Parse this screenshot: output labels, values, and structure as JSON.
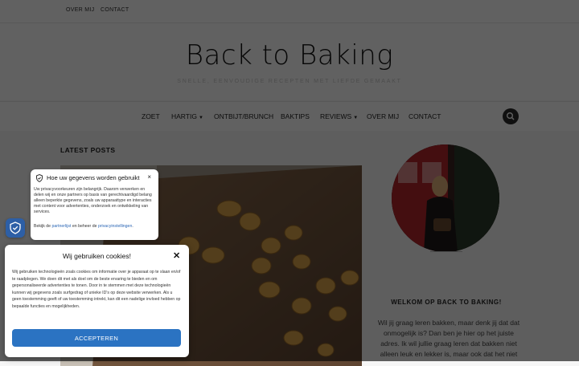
{
  "topnav": {
    "items": [
      {
        "label": "OVER MIJ"
      },
      {
        "label": "CONTACT"
      }
    ]
  },
  "site": {
    "title": "Back to Baking",
    "tagline": "SNELLE, EENVOUDIGE RECEPTEN MET LIEFDE GEMAAKT"
  },
  "mainnav": {
    "items": [
      {
        "label": "ZOET"
      },
      {
        "label": "HARTIG"
      },
      {
        "label": "ONTBIJT/BRUNCH"
      },
      {
        "label": "BAKTIPS"
      },
      {
        "label": "REVIEWS"
      },
      {
        "label": "OVER MIJ"
      },
      {
        "label": "CONTACT"
      }
    ],
    "search_icon": "search-icon"
  },
  "content": {
    "latest_heading": "LATEST POSTS"
  },
  "sidebar": {
    "welcome_title": "WELKOM OP BACK TO BAKING!",
    "about_text": "Wil jij graag leren bakken, maar denk jij dat dat onmogelijk is? Dan ben je hier op het juiste adres. Ik wil jullie graag leren dat bakken niet alleen leuk en lekker is, maar ook dat het niet"
  },
  "privacy_popup": {
    "title": "Hoe uw gegevens worden gebruikt",
    "body": "Uw privacyvoorkeuren zijn belangrijk. Daarom verwerken en delen wij en onze partners op basis van gerechtvaardigd belang alleen beperkte gegevens, zoals uw apparaattype en interacties met content voor advertenties, onderzoek en ontwikkeling van services.",
    "links_prefix": "Bekijk de",
    "partner_link": "partnerlijst",
    "links_middle": "en beheer de",
    "settings_link": "privacyinstellingen",
    "links_suffix": ".",
    "close": "×"
  },
  "cookie_banner": {
    "title": "Wij gebruiken cookies!",
    "close": "✕",
    "body": "Wij gebruiken technologieën zoals cookies om informatie over je apparaat op te slaan en/of te raadplegen. We doen dit met als doel om de beste ervaring te bieden en om gepersonaliseerde advertenties te tonen. Door in te stemmen met deze technologieën kunnen wij gegevens zoals surfgedrag of unieke ID's op deze website verwerken. Als u geen toestemming geeft of uw toestemming intrekt, kan dit een nadelige invloed hebben op bepaalde functies en mogelijkheden.",
    "accept_label": "ACCEPTEREN"
  },
  "colors": {
    "accent_blue": "#2b73c2",
    "shield_blue": "#2d5fa6",
    "link_blue": "#2c67b5",
    "overlay": "rgba(0,0,0,0.62)"
  }
}
